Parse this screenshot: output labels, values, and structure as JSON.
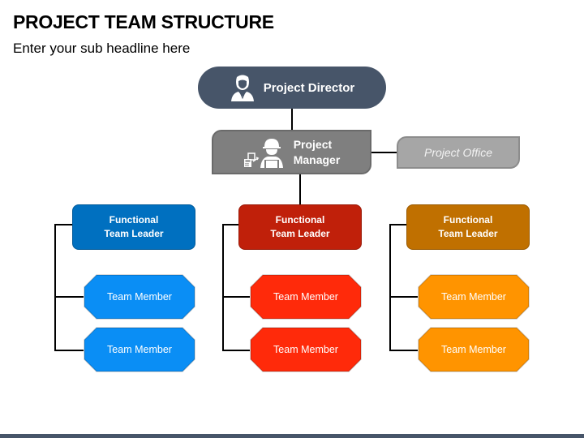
{
  "header": {
    "title": "PROJECT TEAM STRUCTURE",
    "subtitle": "Enter your sub headline here"
  },
  "colors": {
    "director": "#475569",
    "manager": "#7f7f7f",
    "office": "#a6a6a6",
    "footer": "#475569",
    "connector": "#000000"
  },
  "director": {
    "label": "Project Director",
    "icon": "businesswoman-icon"
  },
  "manager": {
    "label_line1": "Project",
    "label_line2": "Manager",
    "icons": [
      "calculator-report-icon",
      "engineer-hardhat-icon"
    ]
  },
  "office": {
    "label": "Project Office"
  },
  "teams": [
    {
      "leader_line1": "Functional",
      "leader_line2": "Team Leader",
      "leader_color": "#0070c0",
      "member_color": "#0a8ef5",
      "members": [
        "Team Member",
        "Team Member"
      ]
    },
    {
      "leader_line1": "Functional",
      "leader_line2": "Team Leader",
      "leader_color": "#c0200a",
      "member_color": "#ff2a0a",
      "members": [
        "Team Member",
        "Team Member"
      ]
    },
    {
      "leader_line1": "Functional",
      "leader_line2": "Team Leader",
      "leader_color": "#c07000",
      "member_color": "#ff9400",
      "members": [
        "Team Member",
        "Team Member"
      ]
    }
  ]
}
